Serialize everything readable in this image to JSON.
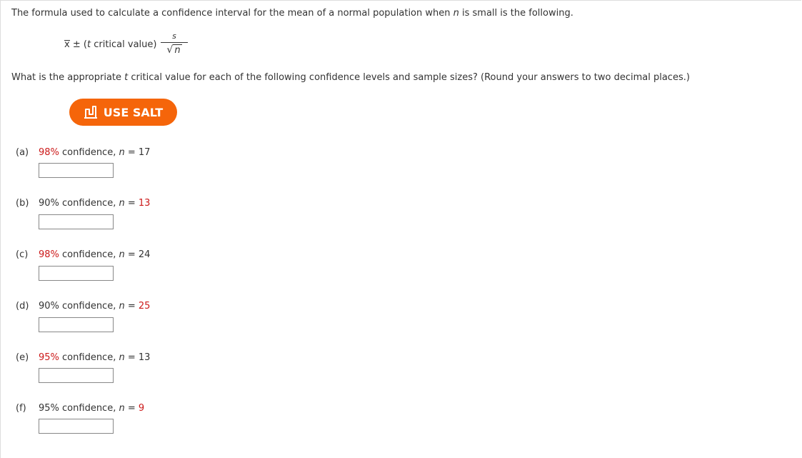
{
  "intro": {
    "pre": "The formula used to calculate a confidence interval for the mean of a normal population when ",
    "var": "n",
    "post": " is small is the following."
  },
  "formula": {
    "xbar": "x",
    "pm": "±",
    "open": "(",
    "t": "t",
    "critical": " critical value)",
    "numerator": "s",
    "sqrt": "√",
    "radicand": "n"
  },
  "question": {
    "pre": "What is the appropriate ",
    "t": "t",
    "post": " critical value for each of the following confidence levels and sample sizes? (Round your answers to two decimal places.)"
  },
  "salt_button": {
    "label": "USE SALT"
  },
  "parts": [
    {
      "letter": "(a)",
      "level": "98%",
      "level_red": true,
      "confidence_text": " confidence, ",
      "n_var": "n",
      "equals": " = ",
      "n_value": "17",
      "n_red": false,
      "answer": ""
    },
    {
      "letter": "(b)",
      "level": "90%",
      "level_red": false,
      "confidence_text": " confidence, ",
      "n_var": "n",
      "equals": " = ",
      "n_value": "13",
      "n_red": true,
      "answer": ""
    },
    {
      "letter": "(c)",
      "level": "98%",
      "level_red": true,
      "confidence_text": " confidence, ",
      "n_var": "n",
      "equals": " = ",
      "n_value": "24",
      "n_red": false,
      "answer": ""
    },
    {
      "letter": "(d)",
      "level": "90%",
      "level_red": false,
      "confidence_text": " confidence, ",
      "n_var": "n",
      "equals": " = ",
      "n_value": "25",
      "n_red": true,
      "answer": ""
    },
    {
      "letter": "(e)",
      "level": "95%",
      "level_red": true,
      "confidence_text": " confidence, ",
      "n_var": "n",
      "equals": " = ",
      "n_value": "13",
      "n_red": false,
      "answer": ""
    },
    {
      "letter": "(f)",
      "level": "95%",
      "level_red": false,
      "confidence_text": " confidence, ",
      "n_var": "n",
      "equals": " = ",
      "n_value": "9",
      "n_red": true,
      "answer": ""
    }
  ],
  "colors": {
    "accent_orange": "#f5650a",
    "highlight_red": "#cc1a1a",
    "text": "#333333"
  },
  "icons": {
    "salt": "salt-icon"
  }
}
